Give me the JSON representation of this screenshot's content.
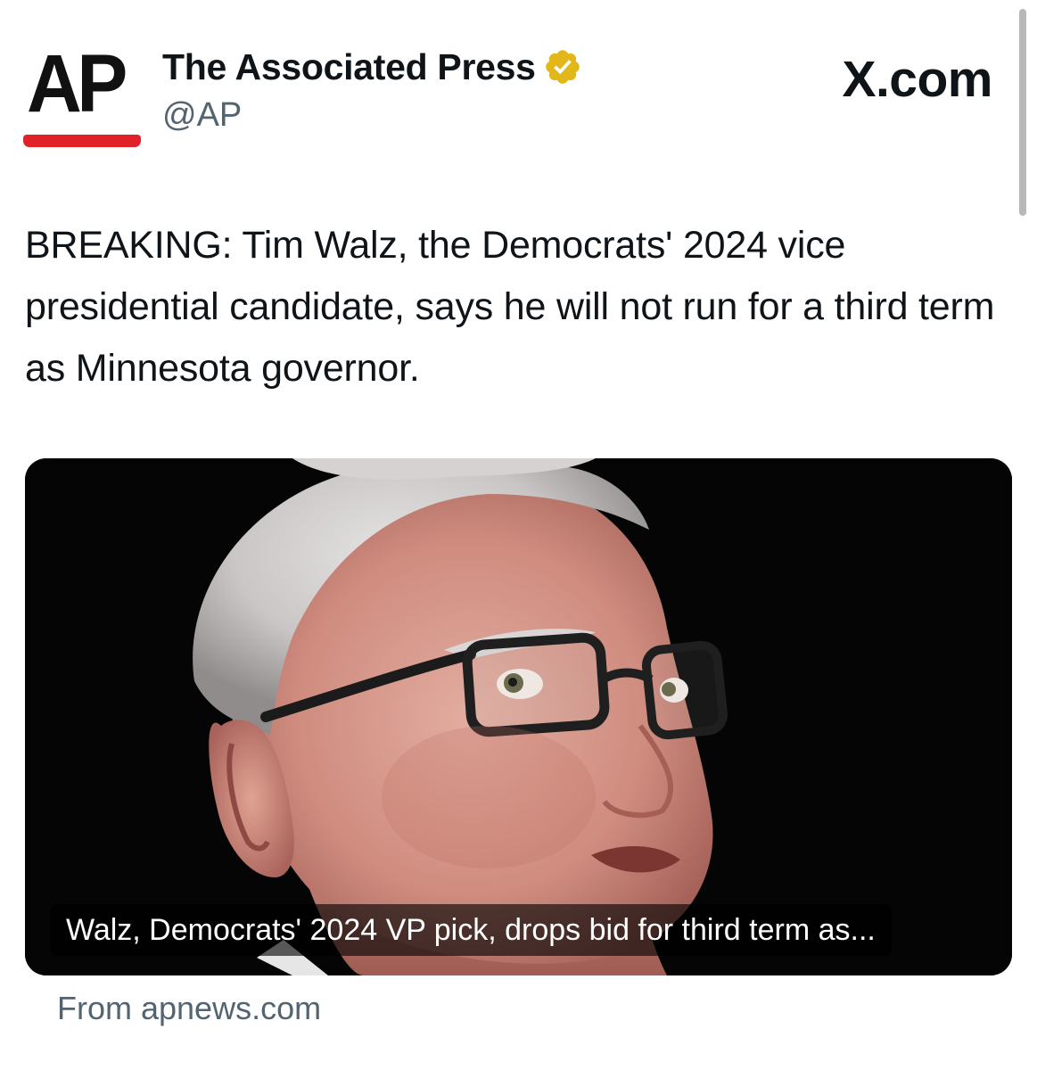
{
  "logo": {
    "text": "AP",
    "accent_color": "#e02127"
  },
  "account": {
    "name": "The Associated Press",
    "handle": "@AP",
    "badge_icon": "verified-badge-icon",
    "badge_color": "#e2b719"
  },
  "site_label": "X.com",
  "tweet": {
    "text": "BREAKING: Tim Walz, the Democrats' 2024 vice presidential candidate, says he will not run for a third term as Minnesota governor."
  },
  "card": {
    "caption": "Walz, Democrats' 2024 VP pick, drops bid for third term as...",
    "source": "From apnews.com"
  }
}
